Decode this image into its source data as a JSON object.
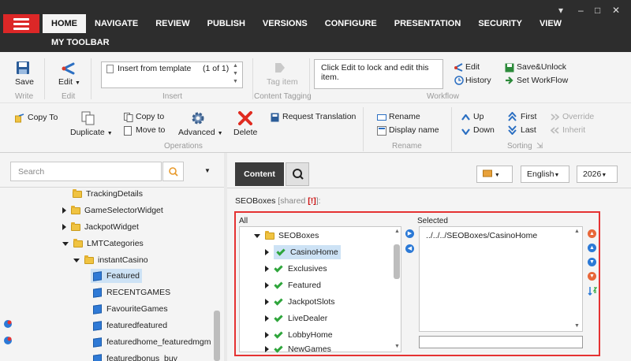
{
  "nav": {
    "tabs": [
      "HOME",
      "NAVIGATE",
      "REVIEW",
      "PUBLISH",
      "VERSIONS",
      "CONFIGURE",
      "PRESENTATION",
      "SECURITY",
      "VIEW"
    ],
    "my_toolbar": "MY TOOLBAR",
    "window_controls": [
      "▾",
      "–",
      "□",
      "✕"
    ]
  },
  "ribbon": {
    "save": "Save",
    "write_group": "Write",
    "edit": "Edit",
    "edit_group": "Edit",
    "insert_template": "Insert from template",
    "template_count": "(1 of 1)",
    "insert_group": "Insert",
    "tag_item": "Tag item",
    "content_tagging_group": "Content Tagging",
    "info_text": "Click Edit to lock and edit this item.",
    "wf_edit": "Edit",
    "wf_history": "History",
    "save_unlock": "Save&Unlock",
    "set_workflow": "Set WorkFlow",
    "workflow_group": "Workflow",
    "copy_to_left": "Copy To",
    "duplicate": "Duplicate",
    "copy_to": "Copy to",
    "move_to": "Move to",
    "advanced": "Advanced",
    "delete": "Delete",
    "request_translation": "Request Translation",
    "operations_group": "Operations",
    "rename": "Rename",
    "display_name": "Display name",
    "rename_group": "Rename",
    "up": "Up",
    "down": "Down",
    "first": "First",
    "last": "Last",
    "override": "Override",
    "inherit": "Inherit",
    "sorting_group": "Sorting"
  },
  "left": {
    "search_placeholder": "Search",
    "tree": [
      {
        "label": "TrackingDetails",
        "kind": "folder",
        "expand": "none"
      },
      {
        "label": "GameSelectorWidget",
        "kind": "folder",
        "expand": "collapsed"
      },
      {
        "label": "JackpotWidget",
        "kind": "folder",
        "expand": "collapsed"
      },
      {
        "label": "LMTCategories",
        "kind": "folder",
        "expand": "expanded"
      },
      {
        "label": "instantCasino",
        "kind": "folder",
        "expand": "expanded"
      },
      {
        "label": "Featured",
        "kind": "item",
        "expand": "none"
      },
      {
        "label": "RECENTGAMES",
        "kind": "item",
        "expand": "none"
      },
      {
        "label": "FavouriteGames",
        "kind": "item",
        "expand": "none"
      },
      {
        "label": "featuredfeatured",
        "kind": "item",
        "expand": "none"
      },
      {
        "label": "featuredhome_featuredmgm",
        "kind": "item",
        "expand": "none"
      },
      {
        "label": "featuredbonus_buy",
        "kind": "item",
        "expand": "none"
      }
    ]
  },
  "right": {
    "content_tab": "Content",
    "language": "English",
    "version": "2026",
    "field_name": "SEOBoxes",
    "shared": "[shared",
    "shared_flag": "[!]",
    "shared_close": "]:",
    "all_label": "All",
    "selected_label": "Selected",
    "all_list": [
      "SEOBoxes",
      "CasinoHome",
      "Exclusives",
      "Featured",
      "JackpotSlots",
      "LiveDealer",
      "LobbyHome",
      "NewGames"
    ],
    "selected_item": "../../../SEOBoxes/CasinoHome"
  }
}
